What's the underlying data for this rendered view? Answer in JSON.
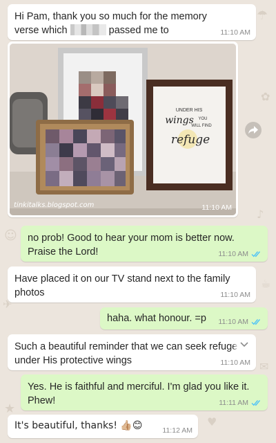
{
  "chat": {
    "messages": [
      {
        "direction": "in",
        "text_before": "Hi Pam, thank you so much for the memory verse which",
        "text_after": "passed me to",
        "time": "11:10 AM"
      },
      {
        "direction": "in",
        "type": "image",
        "watermark": "tinkitalks.blogspot.com",
        "frame_text": [
          "UNDER HIS",
          "wings",
          "YOU",
          "WILL FIND",
          "refuge"
        ],
        "time": "11:10 AM"
      },
      {
        "direction": "out",
        "text": "no prob! Good to hear your mom is better now. Praise the Lord!",
        "time": "11:10 AM",
        "status": "read"
      },
      {
        "direction": "in",
        "text": "Have placed it on our TV stand next to the family photos",
        "time": "11:10 AM"
      },
      {
        "direction": "out",
        "text": "haha. what honour. =p",
        "time": "11:10 AM",
        "status": "read"
      },
      {
        "direction": "in",
        "text": "Such a beautiful reminder that we can seek refuge under His protective wings",
        "time": "11:10 AM"
      },
      {
        "direction": "out",
        "text": "Yes. He is faithful and merciful. I'm glad you like it. Phew!",
        "time": "11:11 AM",
        "status": "read"
      },
      {
        "direction": "in",
        "text": "It's beautiful, thanks! 👍🏼😊",
        "time": "11:12 AM"
      }
    ]
  },
  "icons": {
    "forward": "forward-icon",
    "read_ticks": "double-check-icon",
    "menu": "chevron-down-icon"
  },
  "colors": {
    "wallpaper": "#ece5dd",
    "incoming": "#ffffff",
    "outgoing": "#dcf8c6",
    "read_tick": "#4fc3f7",
    "timestamp": "#8c8c8c"
  }
}
